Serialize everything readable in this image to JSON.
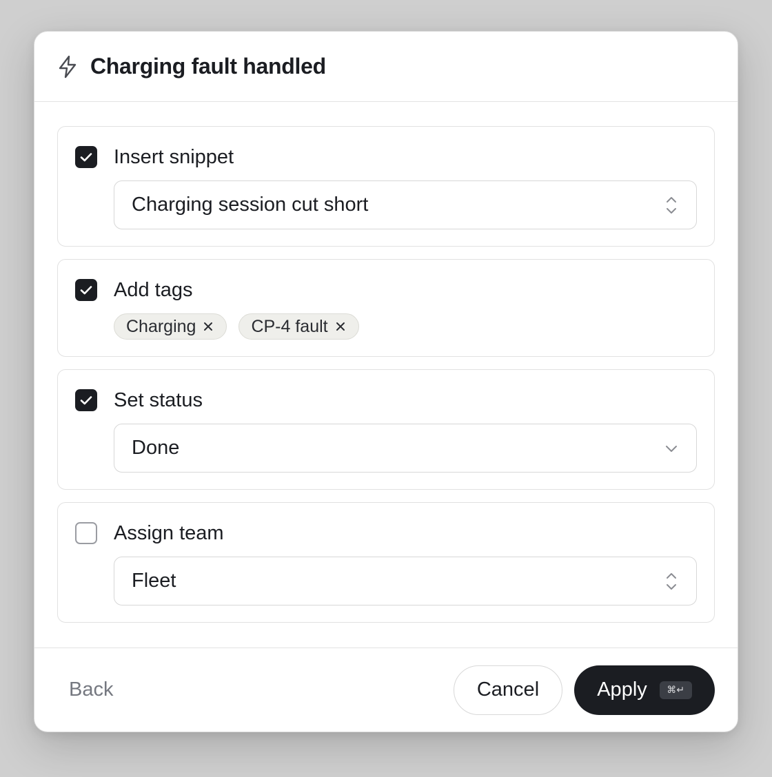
{
  "dialog": {
    "title": "Charging fault handled",
    "title_icon": "lightning-bolt-icon"
  },
  "actions": [
    {
      "label": "Insert snippet",
      "checked": true,
      "control": "select",
      "value": "Charging session cut short",
      "control_icon": "chevron-up-down-icon"
    },
    {
      "label": "Add tags",
      "checked": true,
      "control": "tags",
      "tags": [
        "Charging",
        "CP-4 fault"
      ]
    },
    {
      "label": "Set status",
      "checked": true,
      "control": "select",
      "value": "Done",
      "control_icon": "chevron-down-icon"
    },
    {
      "label": "Assign team",
      "checked": false,
      "control": "select",
      "value": "Fleet",
      "control_icon": "chevron-up-down-icon"
    }
  ],
  "footer": {
    "back_label": "Back",
    "cancel_label": "Cancel",
    "apply_label": "Apply",
    "apply_shortcut": "⌘↵"
  },
  "colors": {
    "primary": "#1b1d22",
    "backdrop": "#cfcfcf",
    "tag_bg": "#efefeb",
    "muted_text": "#757880"
  }
}
